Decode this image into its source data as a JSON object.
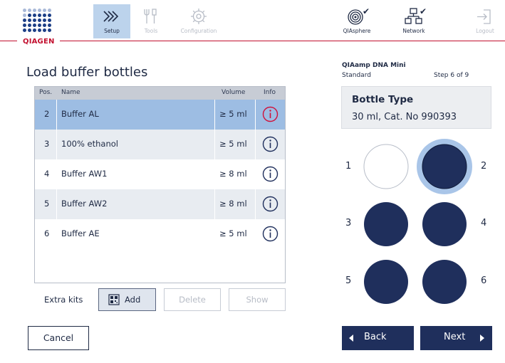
{
  "header": {
    "brand": "QIAGEN",
    "nav": {
      "setup": "Setup",
      "tools": "Tools",
      "configuration": "Configuration",
      "qiasphere": "QIAsphere",
      "network": "Network",
      "logout": "Logout"
    },
    "active_tab": "Setup"
  },
  "page": {
    "title": "Load buffer bottles"
  },
  "table": {
    "headers": {
      "pos": "Pos.",
      "name": "Name",
      "volume": "Volume",
      "info": "Info"
    },
    "rows": [
      {
        "pos": "2",
        "name": "Buffer AL",
        "volume": "≥ 5 ml",
        "selected": true
      },
      {
        "pos": "3",
        "name": "100% ethanol",
        "volume": "≥ 5 ml",
        "selected": false
      },
      {
        "pos": "4",
        "name": "Buffer AW1",
        "volume": "≥ 8 ml",
        "selected": false
      },
      {
        "pos": "5",
        "name": "Buffer AW2",
        "volume": "≥ 8 ml",
        "selected": false
      },
      {
        "pos": "6",
        "name": "Buffer AE",
        "volume": "≥ 5 ml",
        "selected": false
      }
    ]
  },
  "extra_kits": {
    "label": "Extra kits",
    "add": "Add",
    "delete": "Delete",
    "show": "Show"
  },
  "buttons": {
    "cancel": "Cancel",
    "back": "Back",
    "next": "Next"
  },
  "kit": {
    "name": "QIAamp DNA Mini",
    "mode": "Standard",
    "step": "Step 6 of 9"
  },
  "bottle_info": {
    "type_label": "Bottle Type",
    "type_value": "30 ml, Cat. No 990393"
  },
  "rack": {
    "slots": [
      {
        "label": "1",
        "filled": false,
        "highlighted": false
      },
      {
        "label": "2",
        "filled": true,
        "highlighted": true
      },
      {
        "label": "3",
        "filled": true,
        "highlighted": false
      },
      {
        "label": "4",
        "filled": true,
        "highlighted": false
      },
      {
        "label": "5",
        "filled": true,
        "highlighted": false
      },
      {
        "label": "6",
        "filled": true,
        "highlighted": false
      }
    ]
  },
  "colors": {
    "brand_red": "#c2102f",
    "navy": "#1f2f5c",
    "selected_row": "#9dbde3",
    "info_selected": "#d0103a",
    "info": "#1f2f5c"
  }
}
